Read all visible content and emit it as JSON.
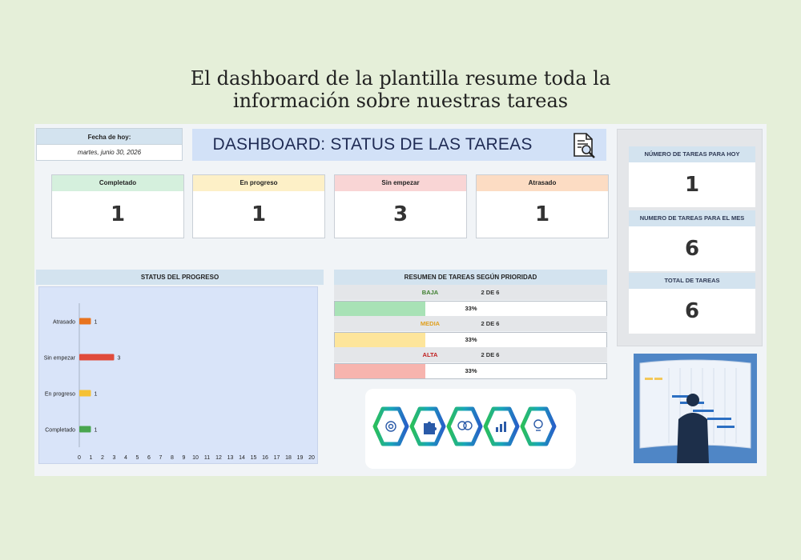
{
  "caption": {
    "line1": "El dashboard de la plantilla resume toda la",
    "line2": "información sobre nuestras tareas"
  },
  "date": {
    "label": "Fecha de hoy:",
    "value": "martes, junio 30, 2026"
  },
  "title": "DASHBOARD: STATUS DE LAS TAREAS",
  "status_cards": [
    {
      "label": "Completado",
      "value": "1",
      "color": "#d5f0dd"
    },
    {
      "label": "En progreso",
      "value": "1",
      "color": "#fdf0c7"
    },
    {
      "label": "Sin empezar",
      "value": "3",
      "color": "#f9d5d5"
    },
    {
      "label": "Atrasado",
      "value": "1",
      "color": "#fcdcc3"
    }
  ],
  "right_panel": {
    "today_label": "NÚMERO DE TAREAS PARA HOY",
    "today_value": "1",
    "month_label": "NUMERO DE TAREAS PARA EL MES",
    "month_value": "6",
    "total_label": "TOTAL DE TAREAS",
    "total_value": "6"
  },
  "chart_header": "STATUS DEL PROGRESO",
  "chart_data": {
    "type": "bar",
    "orientation": "horizontal",
    "categories": [
      "Atrasado",
      "Sin empezar",
      "En progreso",
      "Completado"
    ],
    "values": [
      1,
      3,
      1,
      1
    ],
    "colors": [
      "#e8731f",
      "#e04b3c",
      "#f5c134",
      "#49a64f"
    ],
    "xlim": [
      0,
      20
    ],
    "xticks": [
      0,
      1,
      2,
      3,
      4,
      5,
      6,
      7,
      8,
      9,
      10,
      11,
      12,
      13,
      14,
      15,
      16,
      17,
      18,
      19,
      20
    ]
  },
  "priority": {
    "header": "RESUMEN DE TAREAS SEGÚN PRIORIDAD",
    "rows": [
      {
        "name": "BAJA",
        "count": "2 DE 6",
        "pct": "33%",
        "fraction": 0.333,
        "name_color": "#3f7f2f",
        "fill": "#a8e2b6"
      },
      {
        "name": "MEDIA",
        "count": "2 DE 6",
        "pct": "33%",
        "fraction": 0.333,
        "name_color": "#e0a020",
        "fill": "#fde59b"
      },
      {
        "name": "ALTA",
        "count": "2 DE 6",
        "pct": "33%",
        "fraction": 0.333,
        "name_color": "#c02020",
        "fill": "#f7b4ae"
      }
    ]
  },
  "icons": {
    "title": "document-search-icon",
    "hexagons": [
      "target-icon",
      "puzzle-icon",
      "brain-icon",
      "chart-icon",
      "lightbulb-icon"
    ],
    "promo": "gantt-presentation-image"
  }
}
